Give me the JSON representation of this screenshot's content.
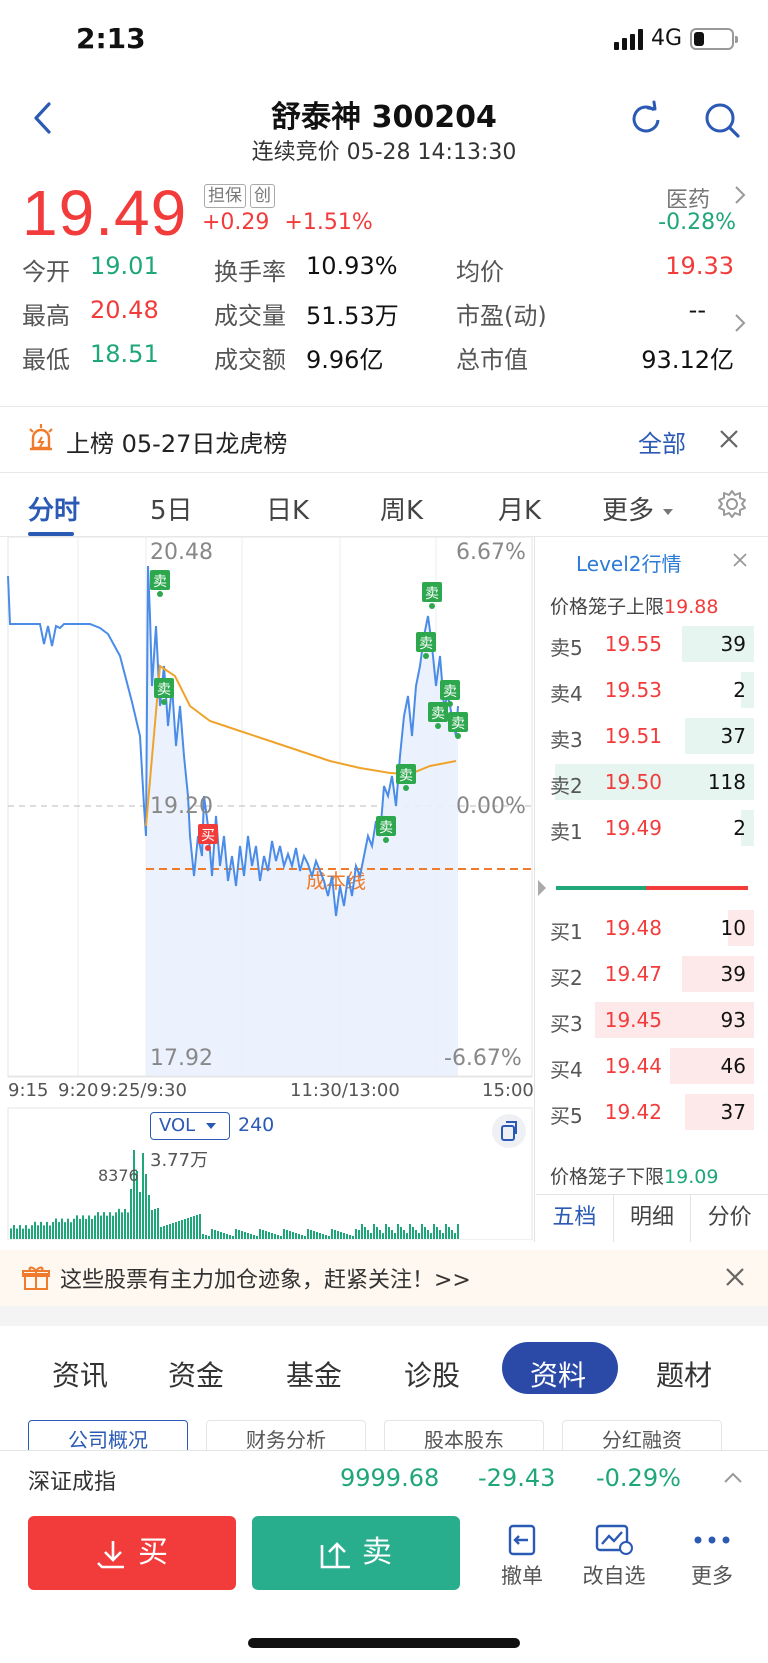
{
  "status_bar": {
    "time": "2:13",
    "network": "4G"
  },
  "header": {
    "title": "舒泰神 300204",
    "subtitle": "连续竞价 05-28 14:13:30"
  },
  "quote": {
    "price": "19.49",
    "tags": [
      "担保",
      "创"
    ],
    "change": "+0.29",
    "change_pct": "+1.51%",
    "sector": "医药",
    "sector_change": "-0.28%"
  },
  "stats": [
    {
      "label": "今开",
      "value": "19.01",
      "color": "#1fa77a"
    },
    {
      "label": "换手率",
      "value": "10.93%",
      "color": "#111111"
    },
    {
      "label": "均价",
      "value": "19.33",
      "color": "#f23b3b"
    },
    {
      "label": "最高",
      "value": "20.48",
      "color": "#f23b3b"
    },
    {
      "label": "成交量",
      "value": "51.53万",
      "color": "#111111"
    },
    {
      "label": "市盈(动)",
      "value": "--",
      "color": "#111111"
    },
    {
      "label": "最低",
      "value": "18.51",
      "color": "#1fa77a"
    },
    {
      "label": "成交额",
      "value": "9.96亿",
      "color": "#111111"
    },
    {
      "label": "总市值",
      "value": "93.12亿",
      "color": "#111111"
    }
  ],
  "banner": {
    "text": "上榜 05-27日龙虎榜",
    "all_label": "全部"
  },
  "tabs": [
    "分时",
    "5日",
    "日K",
    "周K",
    "月K",
    "更多"
  ],
  "chart": {
    "price_high": "20.48",
    "price_mid": "19.20",
    "price_low": "17.92",
    "pct_high": "6.67%",
    "pct_mid": "0.00%",
    "pct_low": "-6.67%",
    "time_labels": [
      "9:15",
      "9:20",
      "9:25/9:30",
      "11:30/13:00",
      "15:00"
    ],
    "cost_line_label": "成本线",
    "sell_label": "卖",
    "buy_label": "买",
    "vol_label": "VOL",
    "vol_value": "240",
    "vol_max": "3.77万",
    "vol_note": "8376",
    "colors": {
      "price_line": "#4a8ce8",
      "avg_line": "#f0a32a",
      "cost_line": "#f07b2c",
      "up": "#f23b3b",
      "down": "#1fa77a"
    }
  },
  "level2": {
    "title": "Level2行情",
    "upper_limit_label": "价格笼子上限",
    "upper_limit_value": "19.88",
    "lower_limit_label": "价格笼子下限",
    "lower_limit_value": "19.09",
    "asks": [
      {
        "label": "卖5",
        "price": "19.55",
        "vol": "39"
      },
      {
        "label": "卖4",
        "price": "19.53",
        "vol": "2"
      },
      {
        "label": "卖3",
        "price": "19.51",
        "vol": "37"
      },
      {
        "label": "卖2",
        "price": "19.50",
        "vol": "118"
      },
      {
        "label": "卖1",
        "price": "19.49",
        "vol": "2"
      }
    ],
    "bids": [
      {
        "label": "买1",
        "price": "19.48",
        "vol": "10"
      },
      {
        "label": "买2",
        "price": "19.47",
        "vol": "39"
      },
      {
        "label": "买3",
        "price": "19.45",
        "vol": "93"
      },
      {
        "label": "买4",
        "price": "19.44",
        "vol": "46"
      },
      {
        "label": "买5",
        "price": "19.42",
        "vol": "37"
      }
    ],
    "tabs": [
      "五档",
      "明细",
      "分价"
    ]
  },
  "promo": {
    "text": "这些股票有主力加仓迹象，赶紧关注！>>"
  },
  "bottom_tabs": [
    "资讯",
    "资金",
    "基金",
    "诊股",
    "资料",
    "题材"
  ],
  "sub_tabs": [
    "公司概况",
    "财务分析",
    "股本股东",
    "分红融资"
  ],
  "index": {
    "name": "深证成指",
    "value": "9999.68",
    "change": "-29.43",
    "change_pct": "-0.29%"
  },
  "actions": {
    "buy": "买",
    "sell": "卖",
    "cancel": "撤单",
    "watchlist": "改自选",
    "more": "更多"
  }
}
